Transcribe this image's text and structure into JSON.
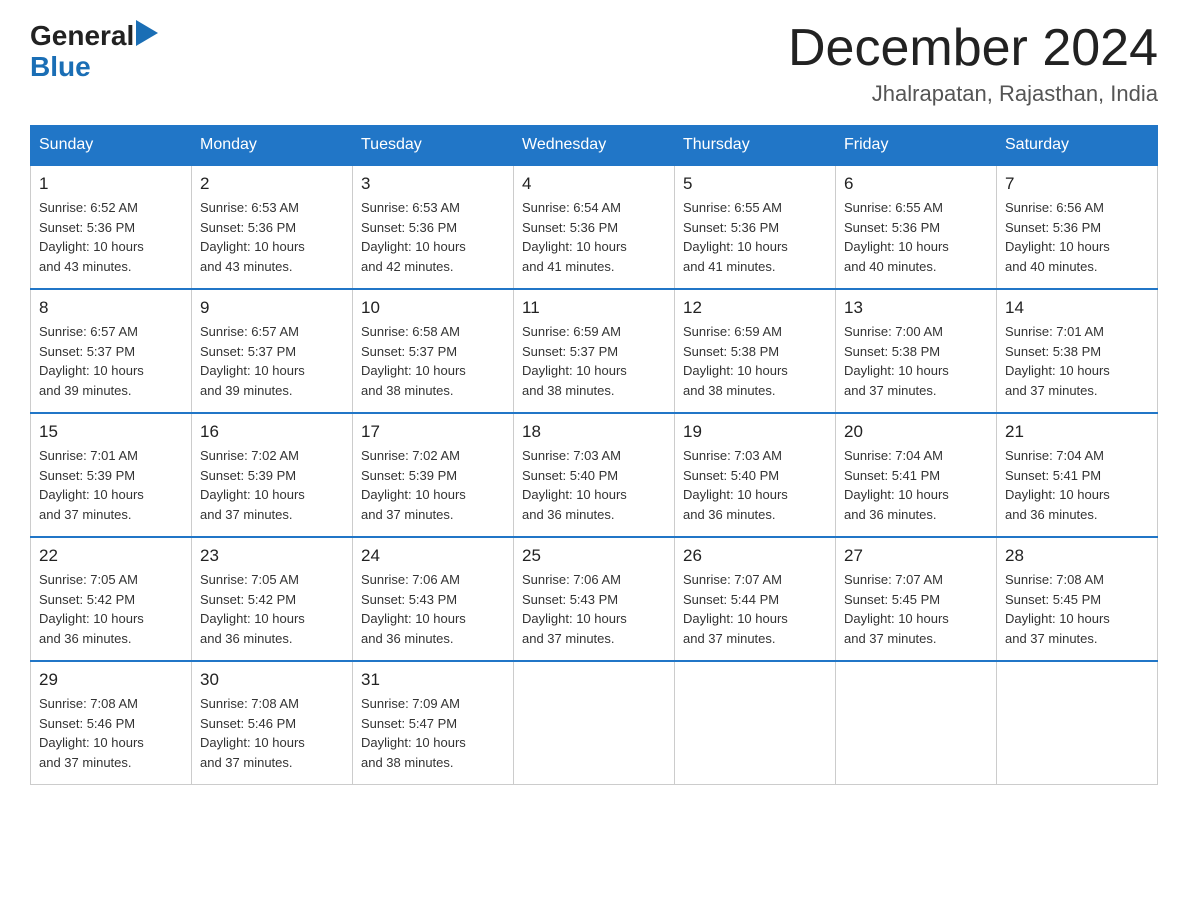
{
  "logo": {
    "general": "General",
    "blue": "Blue",
    "arrow": "▶"
  },
  "header": {
    "month_year": "December 2024",
    "location": "Jhalrapatan, Rajasthan, India"
  },
  "weekdays": [
    "Sunday",
    "Monday",
    "Tuesday",
    "Wednesday",
    "Thursday",
    "Friday",
    "Saturday"
  ],
  "weeks": [
    [
      {
        "day": "1",
        "info": "Sunrise: 6:52 AM\nSunset: 5:36 PM\nDaylight: 10 hours\nand 43 minutes."
      },
      {
        "day": "2",
        "info": "Sunrise: 6:53 AM\nSunset: 5:36 PM\nDaylight: 10 hours\nand 43 minutes."
      },
      {
        "day": "3",
        "info": "Sunrise: 6:53 AM\nSunset: 5:36 PM\nDaylight: 10 hours\nand 42 minutes."
      },
      {
        "day": "4",
        "info": "Sunrise: 6:54 AM\nSunset: 5:36 PM\nDaylight: 10 hours\nand 41 minutes."
      },
      {
        "day": "5",
        "info": "Sunrise: 6:55 AM\nSunset: 5:36 PM\nDaylight: 10 hours\nand 41 minutes."
      },
      {
        "day": "6",
        "info": "Sunrise: 6:55 AM\nSunset: 5:36 PM\nDaylight: 10 hours\nand 40 minutes."
      },
      {
        "day": "7",
        "info": "Sunrise: 6:56 AM\nSunset: 5:36 PM\nDaylight: 10 hours\nand 40 minutes."
      }
    ],
    [
      {
        "day": "8",
        "info": "Sunrise: 6:57 AM\nSunset: 5:37 PM\nDaylight: 10 hours\nand 39 minutes."
      },
      {
        "day": "9",
        "info": "Sunrise: 6:57 AM\nSunset: 5:37 PM\nDaylight: 10 hours\nand 39 minutes."
      },
      {
        "day": "10",
        "info": "Sunrise: 6:58 AM\nSunset: 5:37 PM\nDaylight: 10 hours\nand 38 minutes."
      },
      {
        "day": "11",
        "info": "Sunrise: 6:59 AM\nSunset: 5:37 PM\nDaylight: 10 hours\nand 38 minutes."
      },
      {
        "day": "12",
        "info": "Sunrise: 6:59 AM\nSunset: 5:38 PM\nDaylight: 10 hours\nand 38 minutes."
      },
      {
        "day": "13",
        "info": "Sunrise: 7:00 AM\nSunset: 5:38 PM\nDaylight: 10 hours\nand 37 minutes."
      },
      {
        "day": "14",
        "info": "Sunrise: 7:01 AM\nSunset: 5:38 PM\nDaylight: 10 hours\nand 37 minutes."
      }
    ],
    [
      {
        "day": "15",
        "info": "Sunrise: 7:01 AM\nSunset: 5:39 PM\nDaylight: 10 hours\nand 37 minutes."
      },
      {
        "day": "16",
        "info": "Sunrise: 7:02 AM\nSunset: 5:39 PM\nDaylight: 10 hours\nand 37 minutes."
      },
      {
        "day": "17",
        "info": "Sunrise: 7:02 AM\nSunset: 5:39 PM\nDaylight: 10 hours\nand 37 minutes."
      },
      {
        "day": "18",
        "info": "Sunrise: 7:03 AM\nSunset: 5:40 PM\nDaylight: 10 hours\nand 36 minutes."
      },
      {
        "day": "19",
        "info": "Sunrise: 7:03 AM\nSunset: 5:40 PM\nDaylight: 10 hours\nand 36 minutes."
      },
      {
        "day": "20",
        "info": "Sunrise: 7:04 AM\nSunset: 5:41 PM\nDaylight: 10 hours\nand 36 minutes."
      },
      {
        "day": "21",
        "info": "Sunrise: 7:04 AM\nSunset: 5:41 PM\nDaylight: 10 hours\nand 36 minutes."
      }
    ],
    [
      {
        "day": "22",
        "info": "Sunrise: 7:05 AM\nSunset: 5:42 PM\nDaylight: 10 hours\nand 36 minutes."
      },
      {
        "day": "23",
        "info": "Sunrise: 7:05 AM\nSunset: 5:42 PM\nDaylight: 10 hours\nand 36 minutes."
      },
      {
        "day": "24",
        "info": "Sunrise: 7:06 AM\nSunset: 5:43 PM\nDaylight: 10 hours\nand 36 minutes."
      },
      {
        "day": "25",
        "info": "Sunrise: 7:06 AM\nSunset: 5:43 PM\nDaylight: 10 hours\nand 37 minutes."
      },
      {
        "day": "26",
        "info": "Sunrise: 7:07 AM\nSunset: 5:44 PM\nDaylight: 10 hours\nand 37 minutes."
      },
      {
        "day": "27",
        "info": "Sunrise: 7:07 AM\nSunset: 5:45 PM\nDaylight: 10 hours\nand 37 minutes."
      },
      {
        "day": "28",
        "info": "Sunrise: 7:08 AM\nSunset: 5:45 PM\nDaylight: 10 hours\nand 37 minutes."
      }
    ],
    [
      {
        "day": "29",
        "info": "Sunrise: 7:08 AM\nSunset: 5:46 PM\nDaylight: 10 hours\nand 37 minutes."
      },
      {
        "day": "30",
        "info": "Sunrise: 7:08 AM\nSunset: 5:46 PM\nDaylight: 10 hours\nand 37 minutes."
      },
      {
        "day": "31",
        "info": "Sunrise: 7:09 AM\nSunset: 5:47 PM\nDaylight: 10 hours\nand 38 minutes."
      },
      null,
      null,
      null,
      null
    ]
  ]
}
